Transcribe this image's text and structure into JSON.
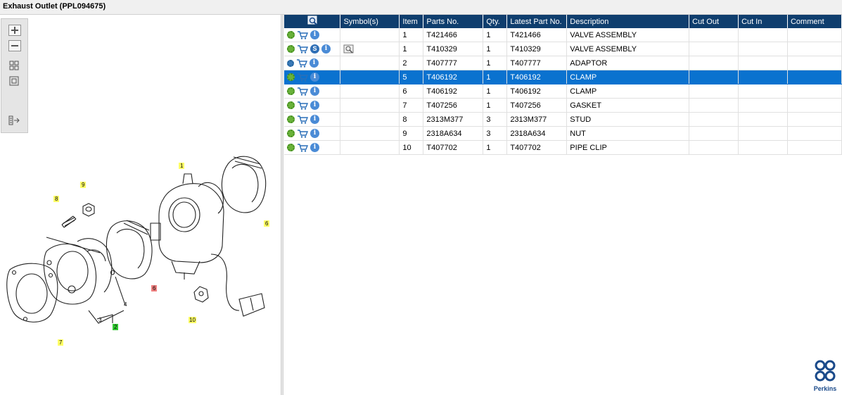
{
  "title": "Exhaust Outlet (PPL094675)",
  "toolbox": {
    "zoom_in_icon": "plus-icon",
    "zoom_out_icon": "minus-icon",
    "fit_icon": "grid-icon",
    "reset_icon": "square-icon",
    "export_icon": "list-arrow-icon"
  },
  "diagram": {
    "callouts": [
      "1",
      "9",
      "8",
      "6",
      "6",
      "10",
      "7",
      "2",
      "3",
      "4"
    ]
  },
  "table": {
    "columns": [
      "Symbol(s)",
      "Item",
      "Parts No.",
      "Qty.",
      "Latest Part No.",
      "Description",
      "Cut Out",
      "Cut In",
      "Comment"
    ],
    "rows": [
      {
        "item": "1",
        "parts_no": "T421466",
        "qty": "1",
        "latest": "T421466",
        "desc": "VALVE ASSEMBLY",
        "cut_out": "",
        "cut_in": "",
        "comment": ""
      },
      {
        "item": "1",
        "parts_no": "T410329",
        "qty": "1",
        "latest": "T410329",
        "desc": "VALVE ASSEMBLY",
        "cut_out": "",
        "cut_in": "",
        "comment": ""
      },
      {
        "item": "2",
        "parts_no": "T407777",
        "qty": "1",
        "latest": "T407777",
        "desc": "ADAPTOR",
        "cut_out": "",
        "cut_in": "",
        "comment": ""
      },
      {
        "item": "5",
        "parts_no": "T406192",
        "qty": "1",
        "latest": "T406192",
        "desc": "CLAMP",
        "cut_out": "",
        "cut_in": "",
        "comment": ""
      },
      {
        "item": "6",
        "parts_no": "T406192",
        "qty": "1",
        "latest": "T406192",
        "desc": "CLAMP",
        "cut_out": "",
        "cut_in": "",
        "comment": ""
      },
      {
        "item": "7",
        "parts_no": "T407256",
        "qty": "1",
        "latest": "T407256",
        "desc": "GASKET",
        "cut_out": "",
        "cut_in": "",
        "comment": ""
      },
      {
        "item": "8",
        "parts_no": "2313M377",
        "qty": "3",
        "latest": "2313M377",
        "desc": "STUD",
        "cut_out": "",
        "cut_in": "",
        "comment": ""
      },
      {
        "item": "9",
        "parts_no": "2318A634",
        "qty": "3",
        "latest": "2318A634",
        "desc": "NUT",
        "cut_out": "",
        "cut_in": "",
        "comment": ""
      },
      {
        "item": "10",
        "parts_no": "T407702",
        "qty": "1",
        "latest": "T407702",
        "desc": "PIPE CLIP",
        "cut_out": "",
        "cut_in": "",
        "comment": ""
      }
    ],
    "selected_row": 3,
    "colors": {
      "header": "#0f3e6e",
      "selected": "#0a72cf"
    }
  },
  "symbols": {
    "s_badge": "S",
    "info_badge": "i"
  },
  "logo": {
    "text": "Perkins"
  }
}
